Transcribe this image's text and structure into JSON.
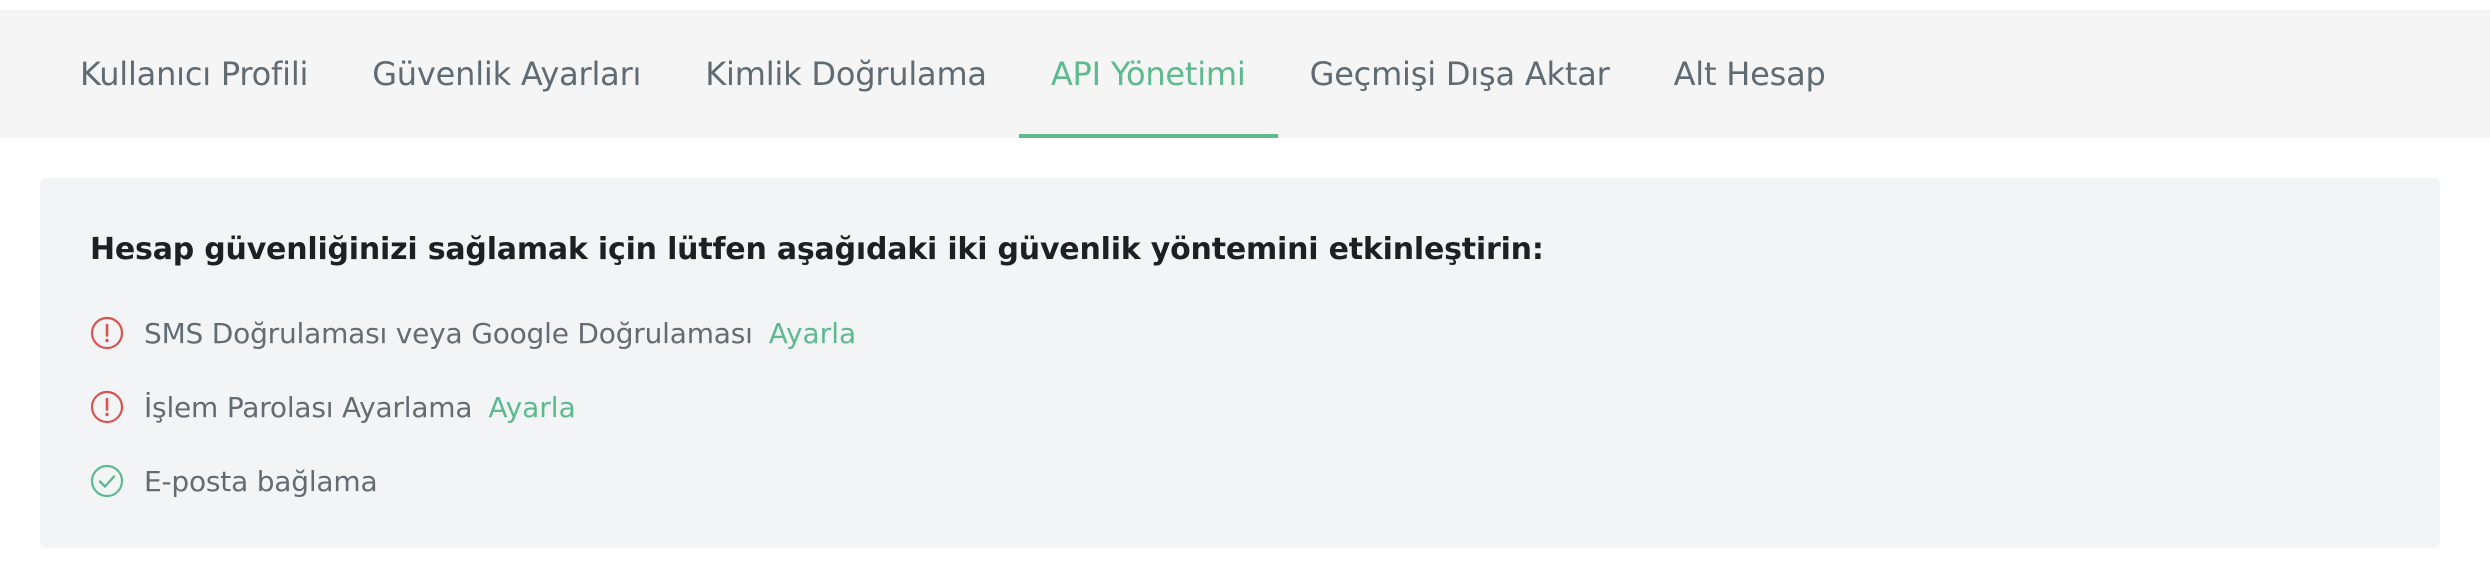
{
  "tabs": [
    {
      "label": "Kullanıcı Profili",
      "active": false
    },
    {
      "label": "Güvenlik Ayarları",
      "active": false
    },
    {
      "label": "Kimlik Doğrulama",
      "active": false
    },
    {
      "label": "API Yönetimi",
      "active": true
    },
    {
      "label": "Geçmişi Dışa Aktar",
      "active": false
    },
    {
      "label": "Alt Hesap",
      "active": false
    }
  ],
  "security": {
    "title": "Hesap güvenliğinizi sağlamak için lütfen aşağıdaki iki güvenlik yöntemini etkinleştirin:",
    "items": [
      {
        "label": "SMS Doğrulaması veya Google Doğrulaması",
        "status": "warning",
        "icon": "alert-circle-icon",
        "action": "Ayarla"
      },
      {
        "label": "İşlem Parolası Ayarlama",
        "status": "warning",
        "icon": "alert-circle-icon",
        "action": "Ayarla"
      },
      {
        "label": "E-posta bağlama",
        "status": "done",
        "icon": "check-circle-icon",
        "action": ""
      }
    ]
  },
  "colors": {
    "accent": "#5db98e",
    "warning": "#d9534f",
    "tabbar_bg": "#f4f5f4",
    "panel_bg": "#f3f4f6"
  }
}
